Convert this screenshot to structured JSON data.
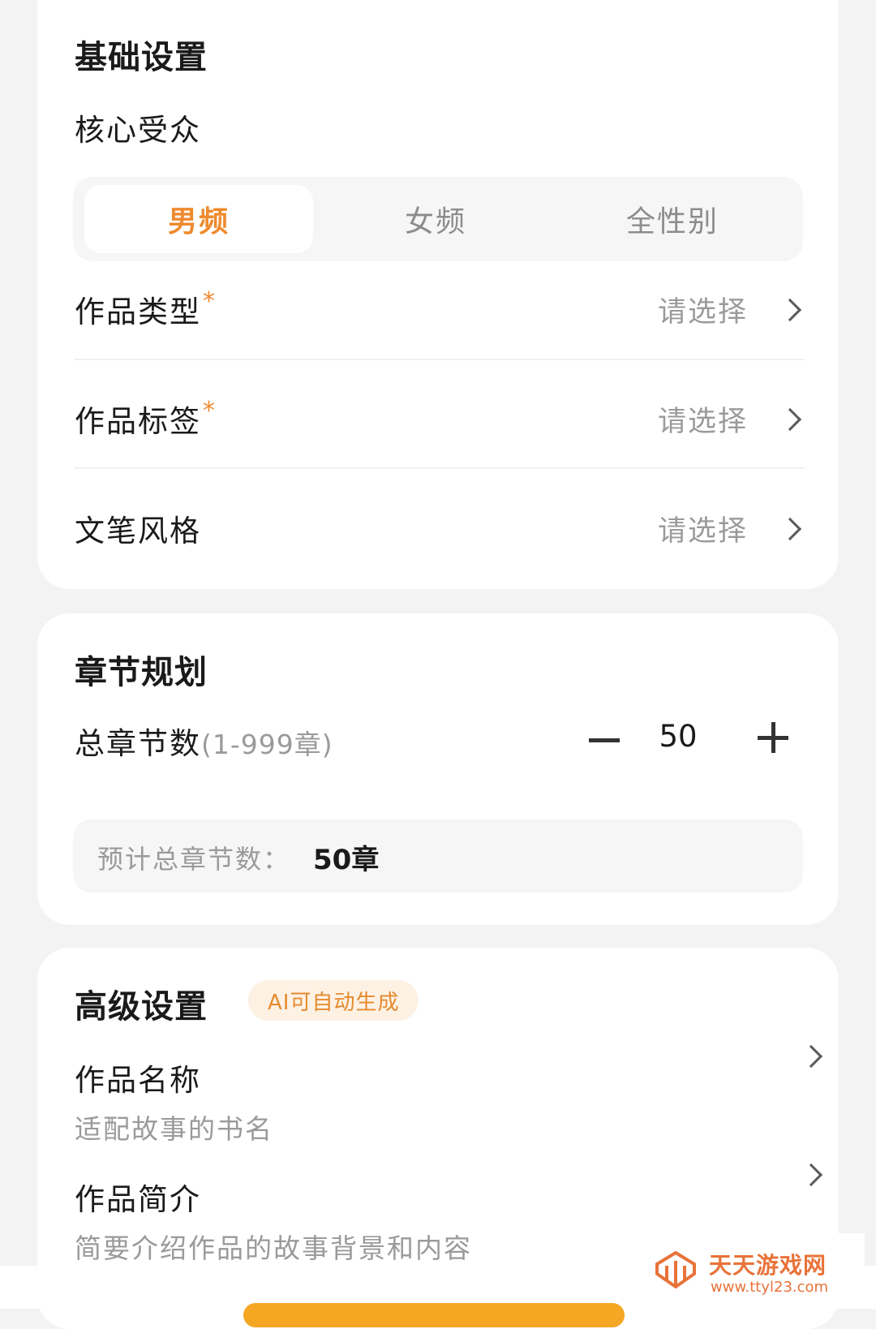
{
  "basic": {
    "title": "基础设置",
    "audience_label": "核心受众",
    "audience_options": [
      "男频",
      "女频",
      "全性别"
    ],
    "audience_selected": "男频",
    "rows": [
      {
        "label": "作品类型",
        "required": "*",
        "value": "请选择"
      },
      {
        "label": "作品标签",
        "required": "*",
        "value": "请选择"
      },
      {
        "label": "文笔风格",
        "required": "",
        "value": "请选择"
      }
    ]
  },
  "chapter": {
    "title": "章节规划",
    "total_label": "总章节数",
    "total_range": "(1-999章)",
    "total_value": "50",
    "estimate_label": "预计总章节数：",
    "estimate_value": "50章"
  },
  "advanced": {
    "title": "高级设置",
    "badge": "AI可自动生成",
    "items": [
      {
        "label": "作品名称",
        "desc": "适配故事的书名"
      },
      {
        "label": "作品简介",
        "desc": "简要介绍作品的故事背景和内容"
      }
    ]
  },
  "watermark": {
    "name": "天天游戏网",
    "url": "www.ttyl23.com"
  },
  "colors": {
    "accent": "#ef8a2e",
    "badge_bg": "#fdf1e4",
    "page_bg": "#f3f3f3"
  }
}
